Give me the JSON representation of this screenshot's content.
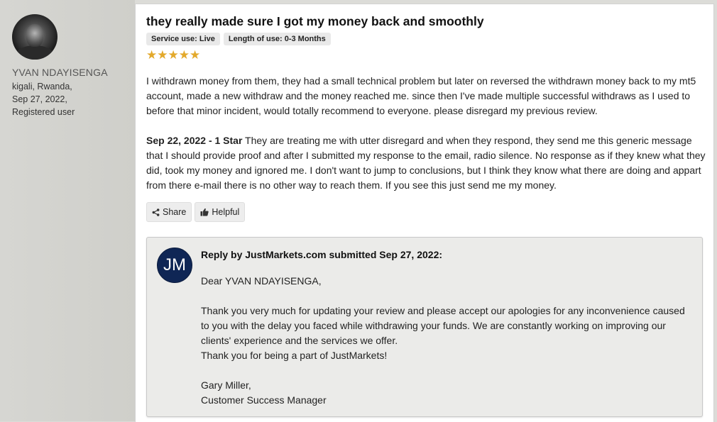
{
  "user": {
    "name": "YVAN NDAYISENGA",
    "location": "kigali, Rwanda,",
    "date": "Sep 27, 2022,",
    "status": "Registered user"
  },
  "review": {
    "title": "they really made sure I got my money back and smoothly",
    "badges": [
      "Service use: Live",
      "Length of use: 0-3 Months"
    ],
    "rating": 5,
    "rating_max": 5,
    "paragraph1": "I withdrawn money from them, they had a small technical problem but later on reversed the withdrawn money back to my mt5 account, made a new withdraw and the money reached me. since then I've made multiple successful withdraws as I used to before that minor incident, would totally recommend to everyone. please disregard my previous review.",
    "previous_label": "Sep 22, 2022 - 1 Star",
    "previous_text": " They are treating me with utter disregard and when they respond, they send me this generic message that I should provide proof and after I submitted my response to the email, radio silence. No response as if they knew what they did, took my money and ignored me. I don't want to jump to conclusions, but I think they know what there are doing and appart from there e-mail there is no other way to reach them. If you see this just send me my money.",
    "share_label": "Share",
    "helpful_label": "Helpful"
  },
  "reply": {
    "logo_text": "JM",
    "header": "Reply by JustMarkets.com submitted Sep 27, 2022:",
    "greeting": "Dear YVAN NDAYISENGA,",
    "body": "Thank you very much for updating your review and please accept our apologies for any inconvenience caused to you with the delay you faced while withdrawing your funds. We are constantly working on improving our clients' experience and the services we offer.",
    "thanks": "Thank you for being a part of JustMarkets!",
    "signature_name": "Gary Miller,",
    "signature_title": "Customer Success Manager"
  },
  "colors": {
    "star": "#e3a92b",
    "logo_bg": "#0f2655",
    "sidebar_bg": "#d6d6d2"
  }
}
